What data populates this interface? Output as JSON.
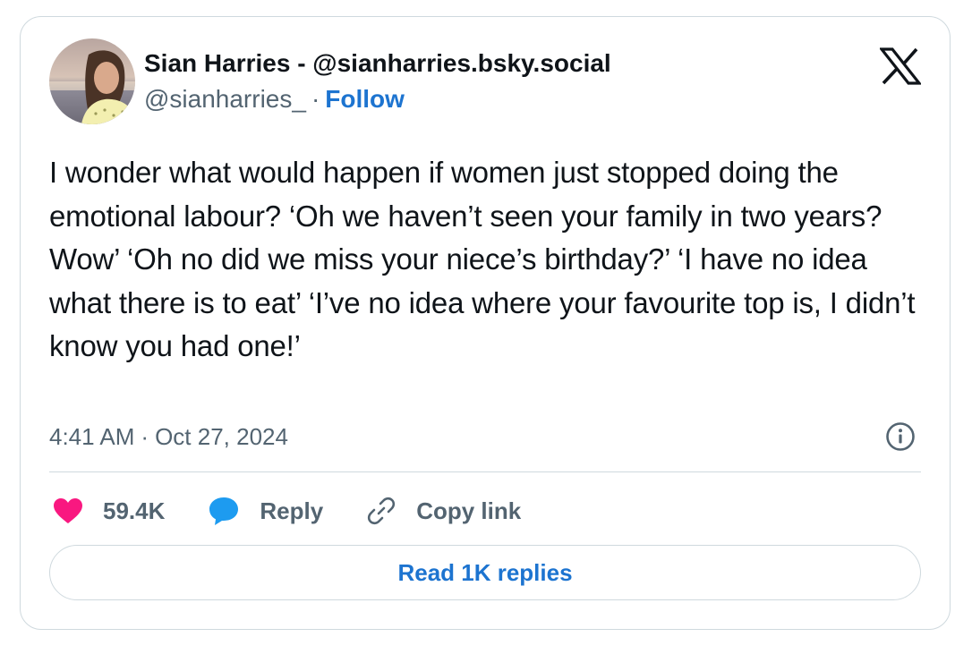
{
  "tweet": {
    "author": {
      "display_name": "Sian Harries - @sianharries.bsky.social",
      "handle": "@sianharries_",
      "separator": "·",
      "follow_label": "Follow",
      "avatar_icon": "profile-photo"
    },
    "platform_icon": "x-logo-icon",
    "text": "I wonder what would happen if women just stopped doing the emotional labour? ‘Oh we haven’t seen your family in two years? Wow’ ‘Oh no did we miss your niece’s birthday?’ ‘I have no idea what there is to eat’ ‘I’ve no idea where your favourite top is, I didn’t know you had one!’",
    "time": "4:41 AM",
    "meta_separator": "·",
    "date": "Oct 27, 2024",
    "actions": {
      "like_count": "59.4K",
      "reply_label": "Reply",
      "copy_link_label": "Copy link"
    },
    "read_replies_label": "Read 1K replies"
  },
  "colors": {
    "accent": "#1d74d0",
    "heart": "#f91880",
    "reply_bubble": "#1d9bf0",
    "muted_text": "#536471",
    "border": "#cfd9de"
  }
}
